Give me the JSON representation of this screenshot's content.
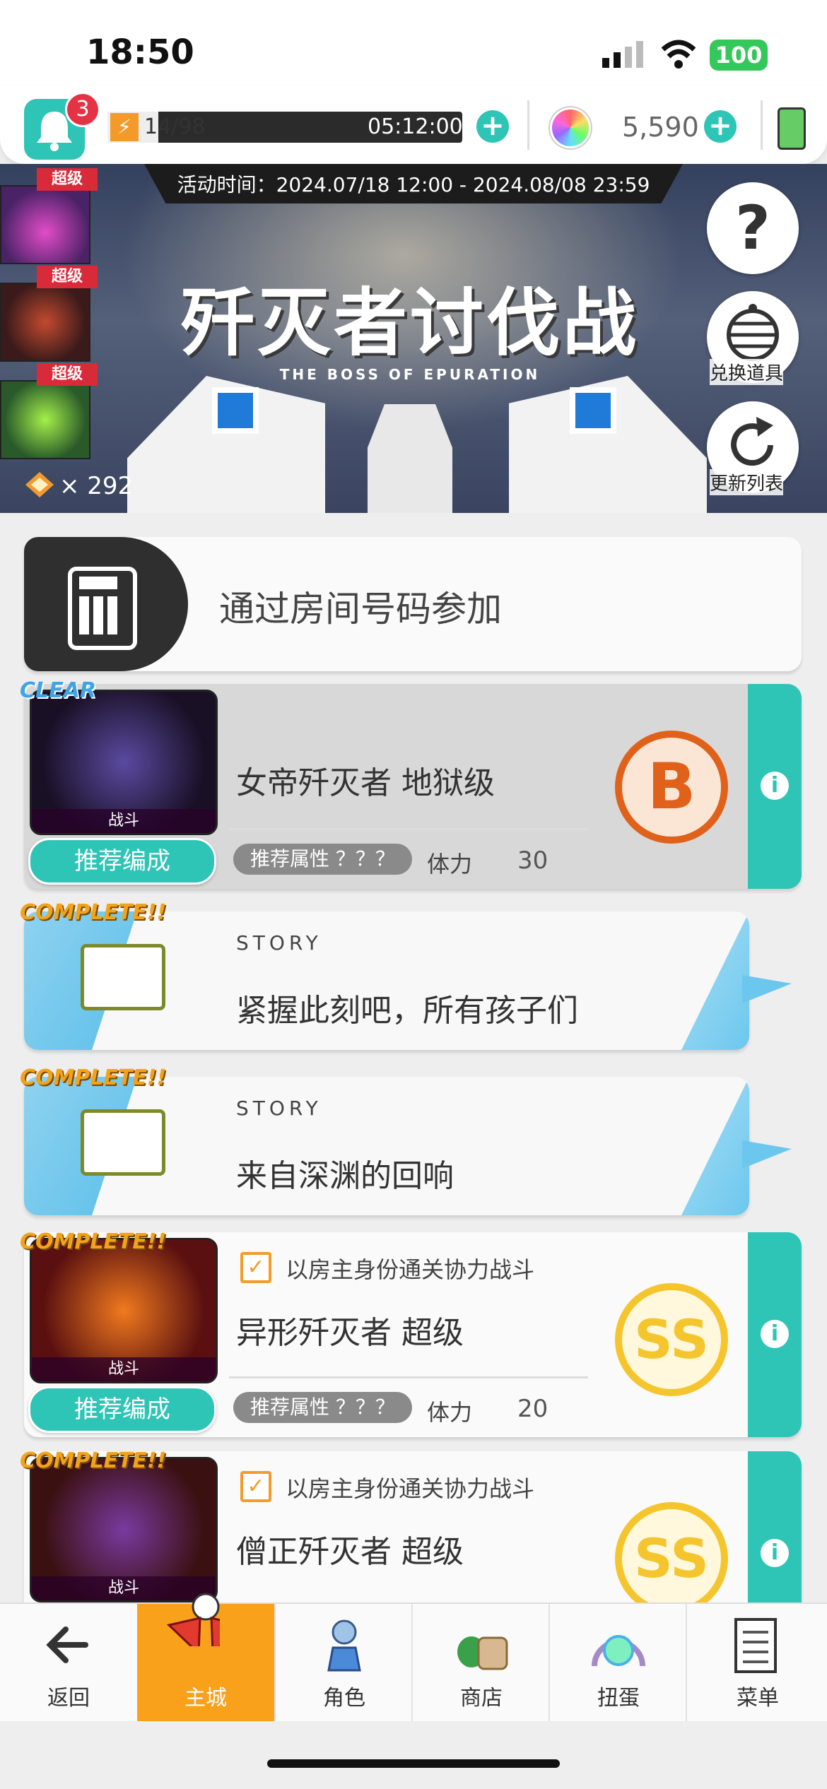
{
  "status_bar": {
    "time": "18:50",
    "battery": "100"
  },
  "top_bar": {
    "notification_count": "3",
    "stamina_value": "14/98",
    "stamina_timer": "05:12:00",
    "stamina_fill": 0.143,
    "gem_count": "5,590"
  },
  "banner": {
    "event_time": "活动时间：2024.07/18 12:00 - 2024.08/08 23:59",
    "title": "歼灭者讨伐战",
    "subtitle": "THE BOSS OF EPURATION",
    "side_tags": [
      "超级",
      "超级",
      "超级"
    ],
    "medal_count": "× 292",
    "help_button": "?",
    "exchange_label": "兑换道具",
    "refresh_label": "更新列表"
  },
  "room_join": {
    "label": "通过房间号码参加"
  },
  "quests": [
    {
      "badge": "CLEAR",
      "thumb_caption": "战斗",
      "name": "女帝歼灭者 地狱级",
      "recommend_label": "推荐编成",
      "attr_label": "推荐属性 ？？？",
      "stamina_label": "体力",
      "stamina_cost": "30",
      "rank": "B"
    },
    {
      "badge": "COMPLETE!!",
      "type_label": "STORY",
      "name": "紧握此刻吧，所有孩子们"
    },
    {
      "badge": "COMPLETE!!",
      "type_label": "STORY",
      "name": "来自深渊的回响"
    },
    {
      "badge": "COMPLETE!!",
      "thumb_caption": "战斗",
      "condition": "以房主身份通关协力战斗",
      "name": "异形歼灭者 超级",
      "recommend_label": "推荐编成",
      "attr_label": "推荐属性 ？？？",
      "stamina_label": "体力",
      "stamina_cost": "20",
      "rank": "SS"
    },
    {
      "badge": "COMPLETE!!",
      "thumb_caption": "战斗",
      "condition": "以房主身份通关协力战斗",
      "name": "僧正歼灭者 超级",
      "rank": "SS"
    }
  ],
  "nav": {
    "back": "返回",
    "main": "主城",
    "character": "角色",
    "shop": "商店",
    "gacha": "扭蛋",
    "menu": "菜单"
  }
}
